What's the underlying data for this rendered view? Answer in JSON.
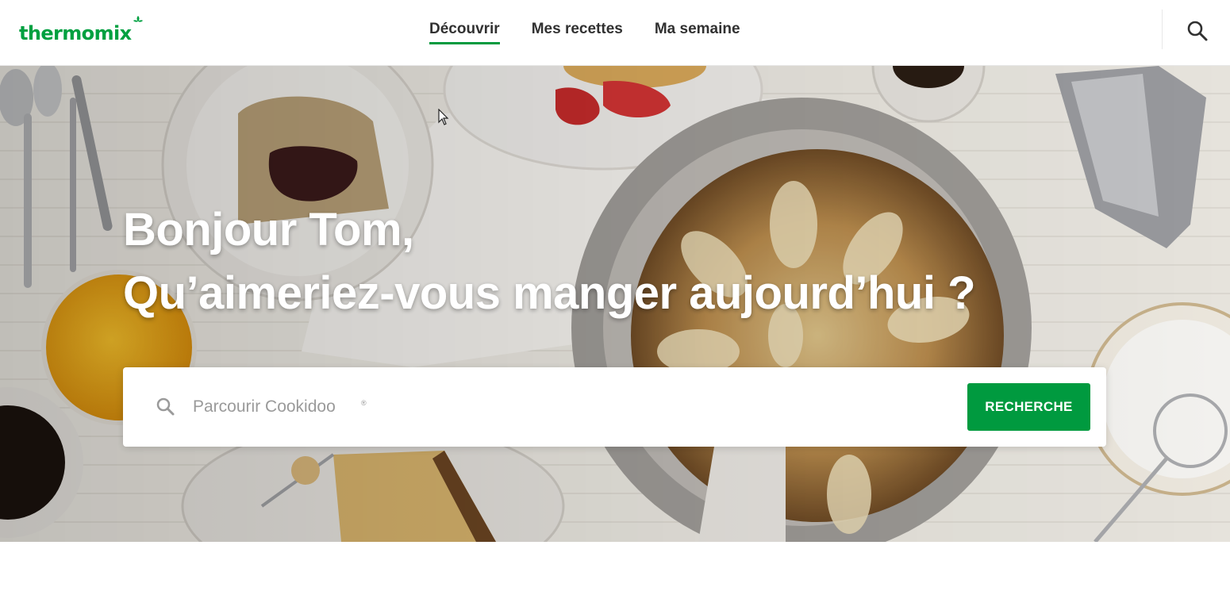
{
  "header": {
    "logo_text": "thermomix",
    "nav": [
      {
        "label": "Découvrir",
        "active": true
      },
      {
        "label": "Mes recettes",
        "active": false
      },
      {
        "label": "Ma semaine",
        "active": false
      }
    ],
    "search_icon": "search-icon"
  },
  "hero": {
    "greeting_line1": "Bonjour Tom,",
    "greeting_line2": "Qu’aimeriez-vous manger aujourd’hui ?",
    "search": {
      "placeholder": "Parcourir Cookidoo",
      "registered_mark": "®",
      "button_label": "RECHERCHE",
      "icon": "search-icon"
    }
  },
  "colors": {
    "brand_green": "#009a3f",
    "text_dark": "#313131",
    "placeholder": "#9a9a9a"
  }
}
